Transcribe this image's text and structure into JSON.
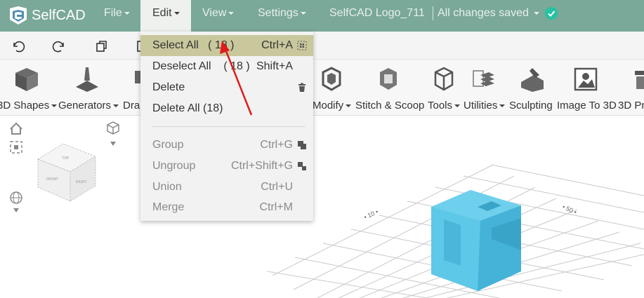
{
  "app": {
    "brand": "SelfCAD",
    "menus": [
      "File",
      "Edit",
      "View",
      "Settings"
    ],
    "filename": "SelfCAD Logo_711",
    "save_status": "All changes saved"
  },
  "ribbon": {
    "labels": {
      "shapes": "3D Shapes",
      "generators": "Generators",
      "draw": "Dra",
      "modify": "Modify",
      "stitch": "Stitch & Scoop",
      "tools": "Tools",
      "utilities": "Utilities",
      "sculpting": "Sculpting",
      "image": "Image To 3D",
      "printing": "3D Pr"
    }
  },
  "edit_menu": {
    "select_all": {
      "label": "Select All   ( 18 )",
      "shortcut": "Ctrl+A"
    },
    "deselect_all": {
      "label": "Deselect All    ( 18 )",
      "shortcut": "Shift+A"
    },
    "delete": {
      "label": "Delete"
    },
    "delete_all": {
      "label": "Delete All (18)"
    },
    "group": {
      "label": "Group",
      "shortcut": "Ctrl+G"
    },
    "ungroup": {
      "label": "Ungroup",
      "shortcut": "Ctrl+Shift+G"
    },
    "union": {
      "label": "Union",
      "shortcut": "Ctrl+U"
    },
    "merge": {
      "label": "Merge",
      "shortcut": "Ctrl+M"
    }
  },
  "colors": {
    "menubar": "#7aa899",
    "highlight": "#c9c79c",
    "object": "#57c3e4",
    "annotation_arrow": "#e01b1b"
  }
}
